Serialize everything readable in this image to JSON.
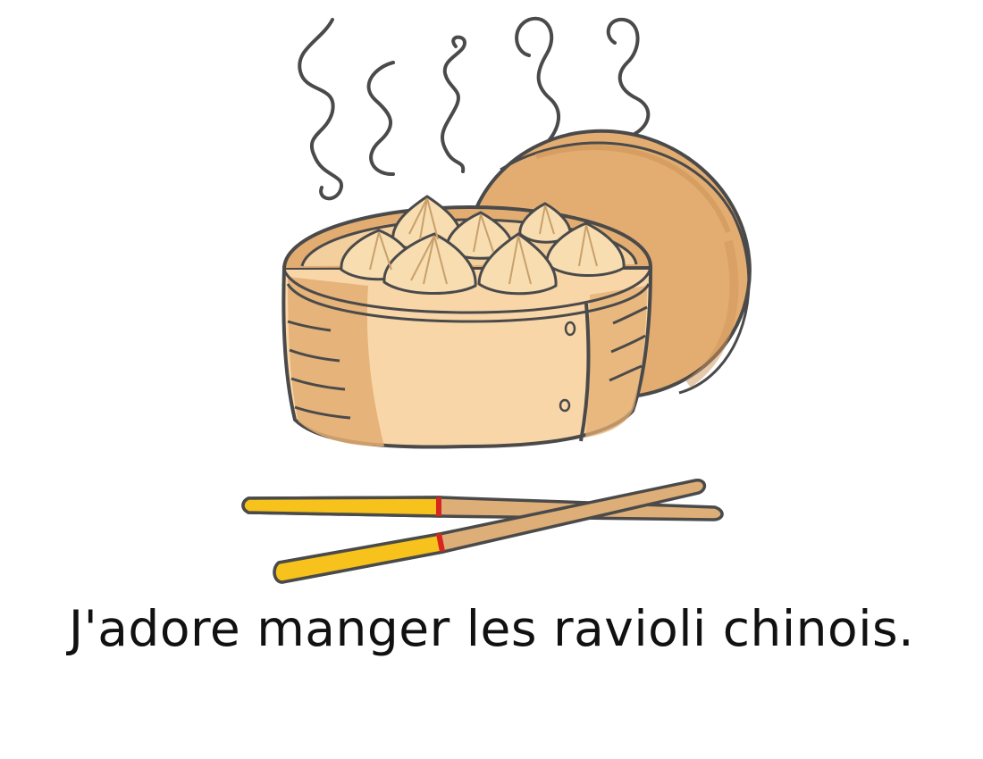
{
  "caption": "J'adore manger les ravioli chinois.",
  "colors": {
    "outline": "#4a4a4a",
    "bamboo_light": "#f9d6a8",
    "bamboo_dark": "#e3ad72",
    "dumpling": "#f7ddb0",
    "dumpling_shade": "#e9c38a",
    "chopstick_tip": "#f6c21b",
    "chopstick_wood": "#deae78",
    "chopstick_band": "#d7261e",
    "steam": "#4a4a4a"
  },
  "icons": [
    "steam-icon",
    "bamboo-steamer-icon",
    "steamer-lid-icon",
    "dumpling-icon",
    "chopsticks-icon"
  ]
}
